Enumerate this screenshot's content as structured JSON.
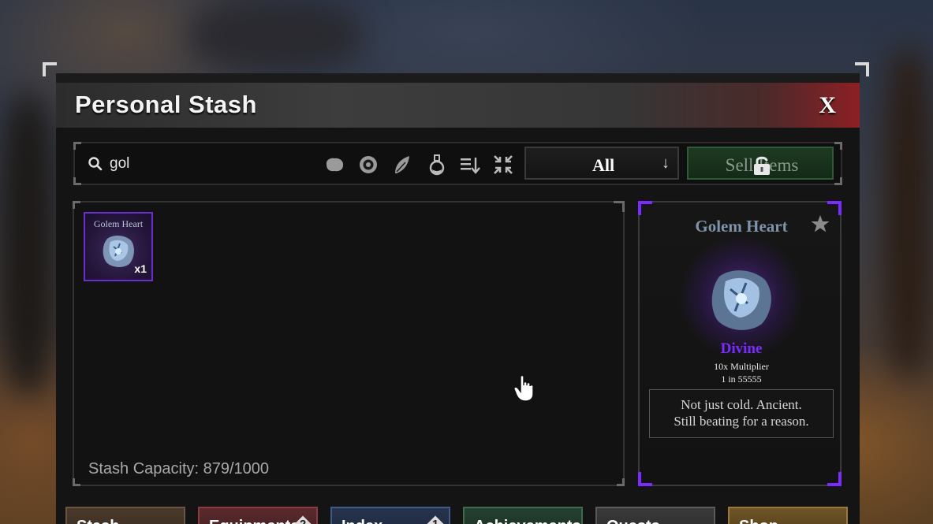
{
  "window": {
    "title": "Personal Stash",
    "close_label": "X"
  },
  "toolbar": {
    "search": {
      "value": "gol",
      "placeholder": ""
    },
    "filter_icons": [
      "ore-icon",
      "orb-icon",
      "leaf-icon",
      "potion-icon",
      "sort-icon",
      "collapse-icon"
    ],
    "rarity_filter": {
      "selected": "All"
    },
    "sell_button_label": "Sell Items"
  },
  "inventory": {
    "items": [
      {
        "name": "Golem Heart",
        "quantity": "x1",
        "rarity": "Divine"
      }
    ],
    "capacity_text": "Stash Capacity: 879/1000"
  },
  "detail": {
    "name": "Golem Heart",
    "rarity": "Divine",
    "multiplier": "10x Multiplier",
    "chance": "1 in 55555",
    "description_line1": "Not just cold. Ancient.",
    "description_line2": "Still beating for a reason."
  },
  "tabs": [
    {
      "label": "Stash",
      "badge": ""
    },
    {
      "label": "Equipments",
      "badge": "2"
    },
    {
      "label": "Index",
      "badge": "1"
    },
    {
      "label": "Achievements",
      "badge": ""
    },
    {
      "label": "Quests",
      "badge": ""
    },
    {
      "label": "Shop",
      "badge": ""
    }
  ],
  "colors": {
    "accent_purple": "#7a2cff",
    "title_red": "#8c1f24",
    "sell_green": "#1e3a22",
    "item_name": "#7f93a9"
  }
}
